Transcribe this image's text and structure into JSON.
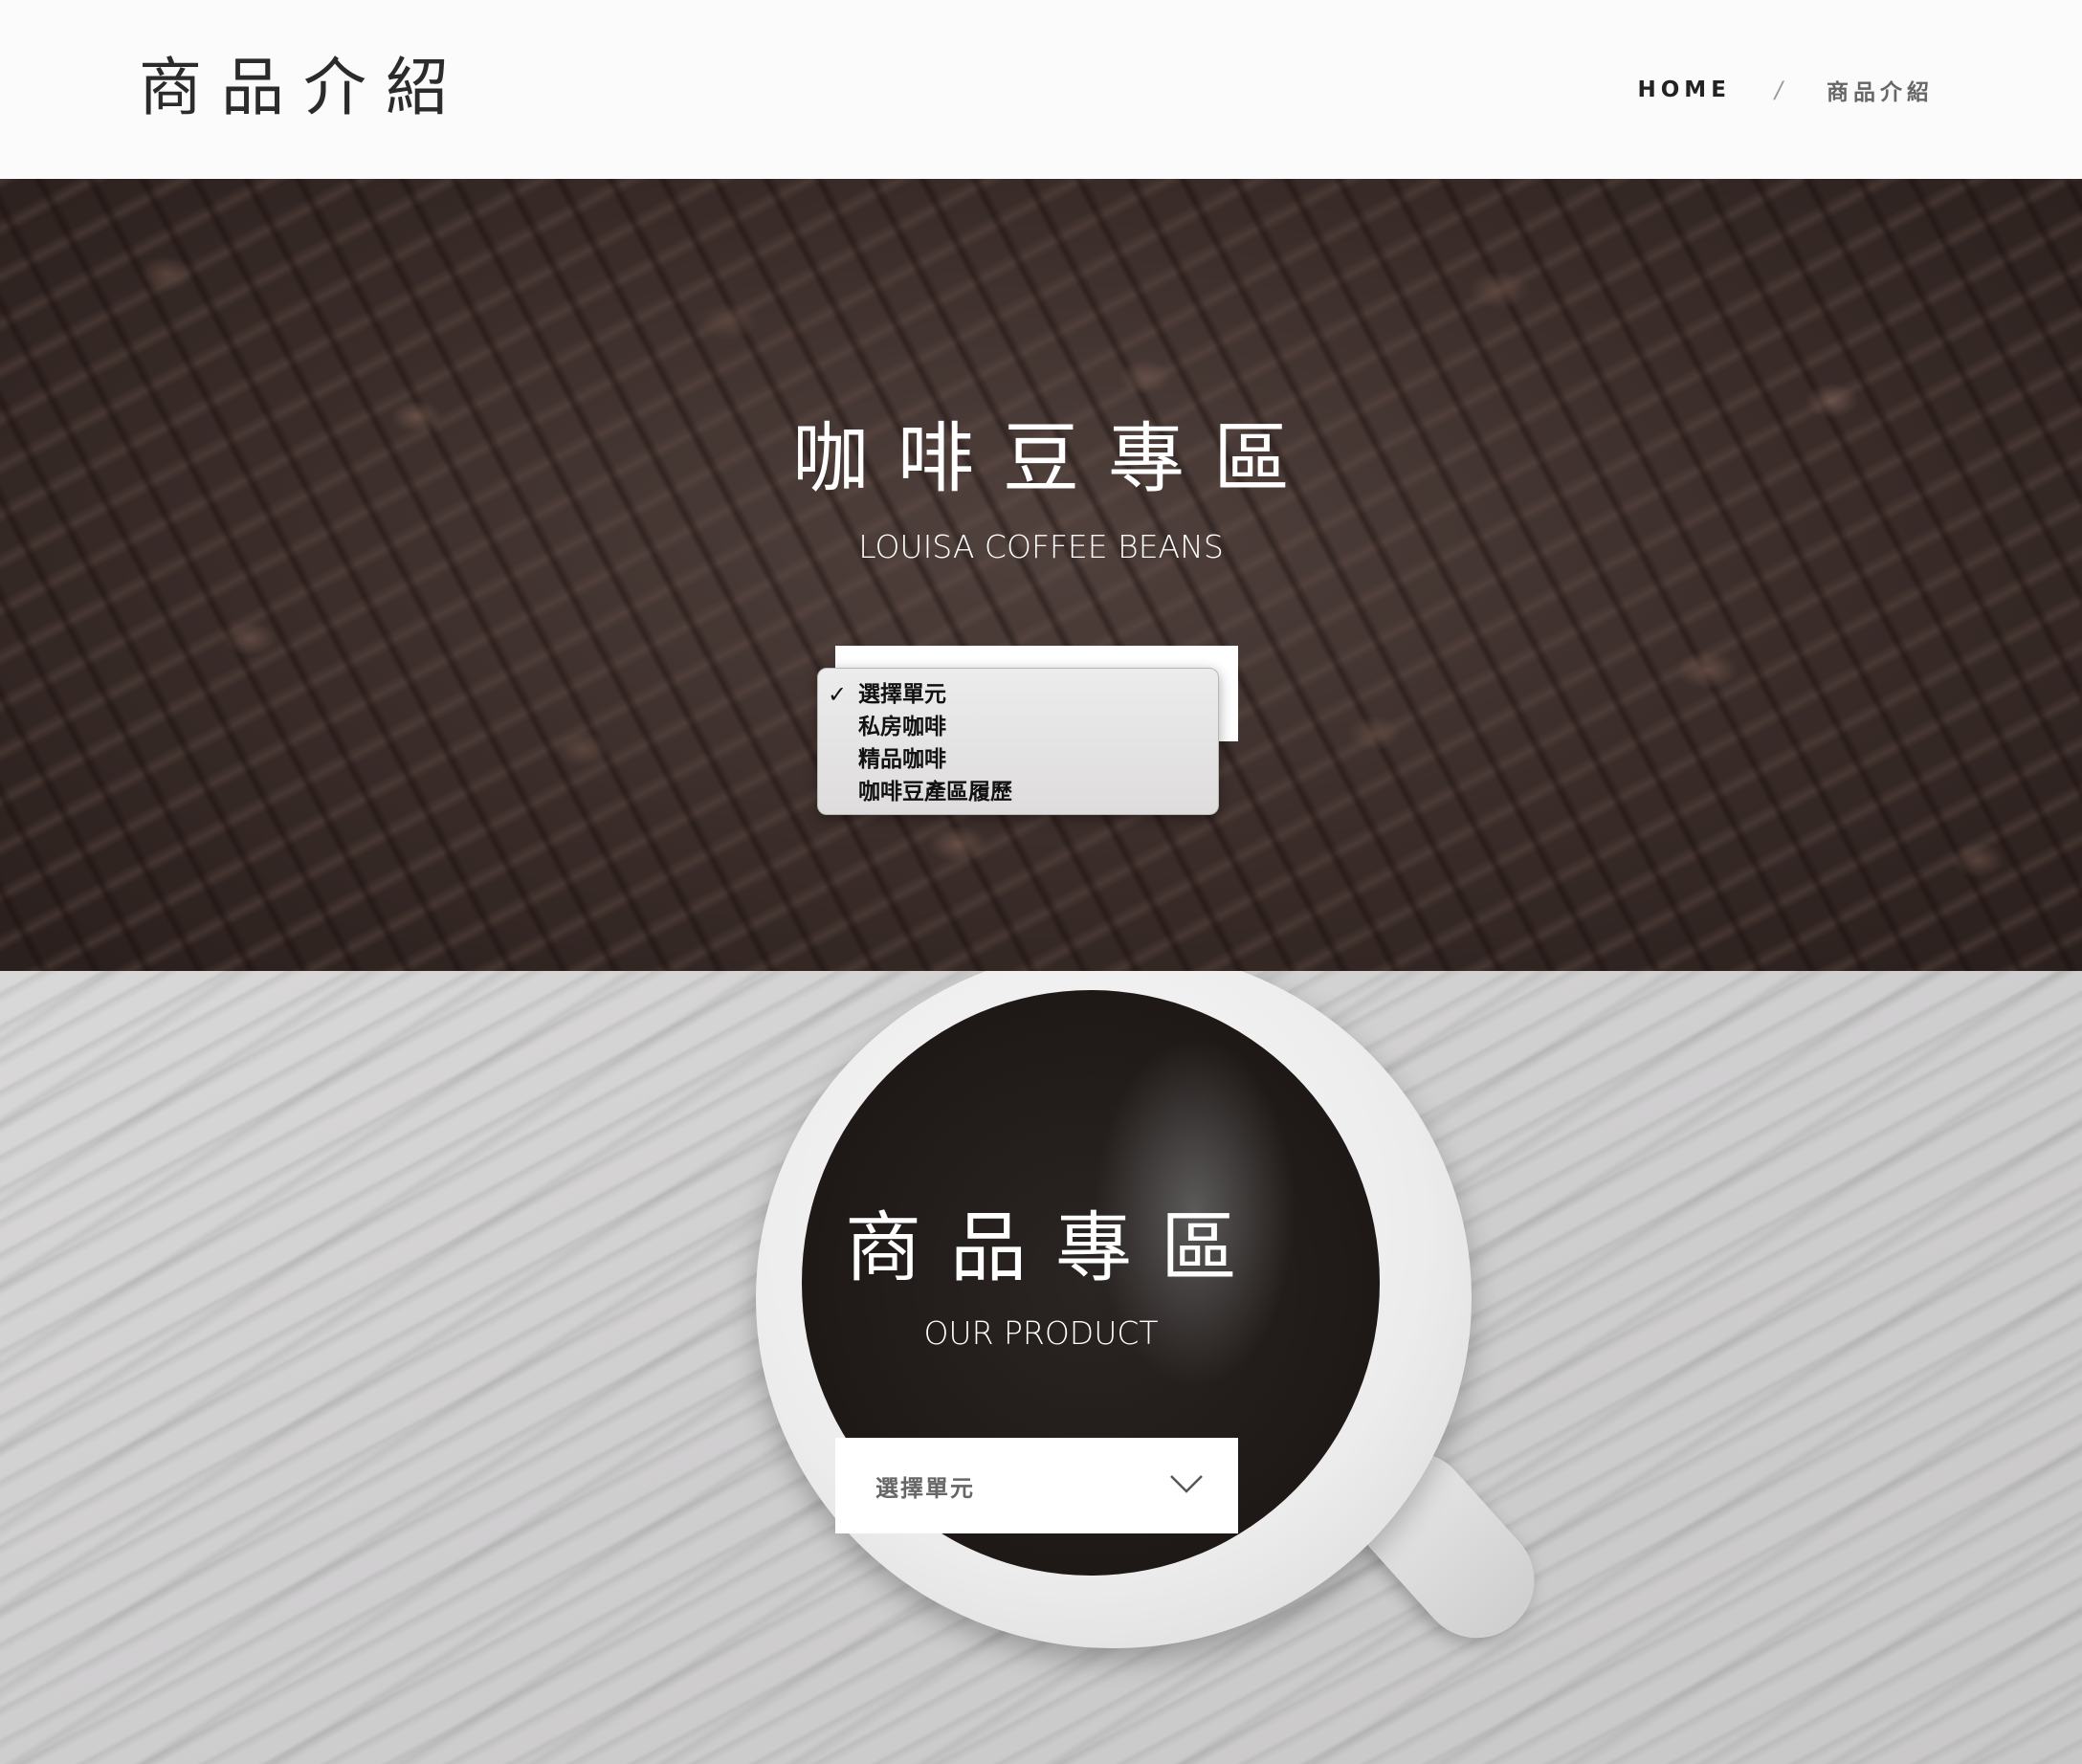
{
  "header": {
    "title": "商品介紹",
    "breadcrumb": {
      "home": "HOME",
      "separator": "/",
      "current": "商品介紹"
    }
  },
  "beans_section": {
    "title_zh": "咖啡豆專區",
    "title_en": "LOUISA COFFEE BEANS",
    "select": {
      "selected": "選擇單元",
      "options": [
        "選擇單元",
        "私房咖啡",
        "精品咖啡",
        "咖啡豆產區履歷"
      ],
      "open": true
    }
  },
  "product_section": {
    "title_zh": "商品專區",
    "title_en": "OUR PRODUCT",
    "select": {
      "selected": "選擇單元",
      "open": false
    }
  },
  "icons": {
    "check": "check-icon",
    "chevron": "chevron-down-icon"
  },
  "colors": {
    "header_bg": "#fbfbfb",
    "title_text": "#2b2b2b",
    "hero_text": "#ffffff",
    "select_bg": "#ffffff"
  }
}
